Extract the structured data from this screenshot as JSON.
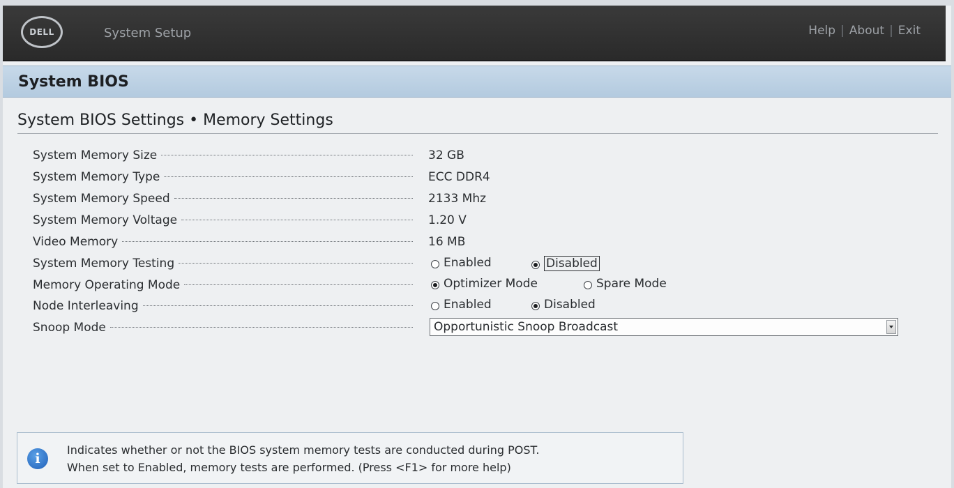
{
  "header": {
    "logo_text": "DELL",
    "app_title": "System Setup",
    "nav": {
      "help": "Help",
      "about": "About",
      "exit": "Exit",
      "separator": "|"
    }
  },
  "section": {
    "title": "System BIOS"
  },
  "breadcrumb": "System BIOS Settings • Memory Settings",
  "settings": {
    "memory_size": {
      "label": "System Memory Size",
      "value": "32 GB"
    },
    "memory_type": {
      "label": "System Memory Type",
      "value": "ECC DDR4"
    },
    "memory_speed": {
      "label": "System Memory Speed",
      "value": "2133 Mhz"
    },
    "memory_voltage": {
      "label": "System Memory Voltage",
      "value": "1.20 V"
    },
    "video_memory": {
      "label": "Video Memory",
      "value": "16 MB"
    },
    "memory_testing": {
      "label": "System Memory Testing",
      "options": [
        "Enabled",
        "Disabled"
      ],
      "selected": "Disabled"
    },
    "operating_mode": {
      "label": "Memory Operating Mode",
      "options": [
        "Optimizer Mode",
        "Spare Mode"
      ],
      "selected": "Optimizer Mode"
    },
    "node_interleaving": {
      "label": "Node Interleaving",
      "options": [
        "Enabled",
        "Disabled"
      ],
      "selected": "Disabled"
    },
    "snoop_mode": {
      "label": "Snoop Mode",
      "value": "Opportunistic Snoop Broadcast"
    }
  },
  "help": {
    "icon": "info-icon",
    "line1": "Indicates whether or not the BIOS system memory tests are conducted during POST.",
    "line2": "When set to Enabled, memory tests are performed. (Press <F1> for more help)"
  }
}
